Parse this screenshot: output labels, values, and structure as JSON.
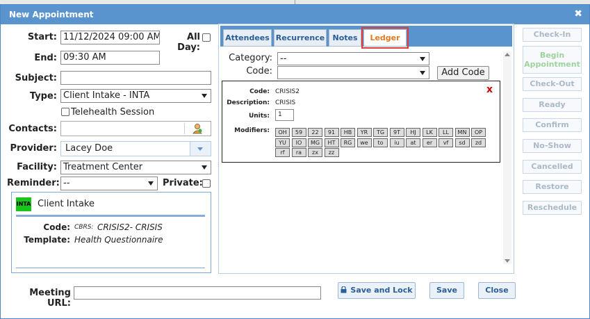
{
  "dialog": {
    "title": "New Appointment",
    "close_glyph": "✖"
  },
  "form": {
    "start_label": "Start:",
    "start_value": "11/12/2024 09:00 AM",
    "allday_label": "All Day:",
    "end_label": "End:",
    "end_value": "09:30 AM",
    "subject_label": "Subject:",
    "subject_value": "",
    "type_label": "Type:",
    "type_value": "Client Intake - INTA",
    "telehealth_label": "Telehealth Session",
    "contacts_label": "Contacts:",
    "contacts_value": "",
    "provider_label": "Provider:",
    "provider_value": "Lacey Doe",
    "facility_label": "Facility:",
    "facility_value": "Treatment Center",
    "reminder_label": "Reminder:",
    "reminder_value": "--",
    "private_label": "Private:"
  },
  "summary": {
    "badge": "INTA",
    "badge_color": "#19c41c",
    "title": "Client Intake",
    "code_label": "Code:",
    "code_prefix": "CBRS:",
    "code_value": "CRISIS2- CRISIS",
    "template_label": "Template:",
    "template_value": "Health Questionnaire"
  },
  "tabs": [
    {
      "label": "Attendees"
    },
    {
      "label": "Recurrence"
    },
    {
      "label": "Notes"
    },
    {
      "label": "Ledger"
    }
  ],
  "active_tab": "Ledger",
  "ledger": {
    "category_label": "Category:",
    "category_value": "--",
    "code_label": "Code:",
    "code_value": "",
    "add_code_label": "Add Code",
    "entry": {
      "code_label": "Code:",
      "code_value": "CRISIS2",
      "description_label": "Description:",
      "description_value": "CRISIS",
      "units_label": "Units:",
      "units_value": "1",
      "modifiers_label": "Modifiers:",
      "remove_glyph": "x",
      "modifiers": [
        "OH",
        "59",
        "22",
        "91",
        "HB",
        "YR",
        "TG",
        "9T",
        "HJ",
        "LK",
        "LL",
        "MN",
        "OP",
        "YU",
        "IO",
        "MG",
        "HT",
        "RG",
        "we",
        "to",
        "iu",
        "at",
        "er",
        "vf",
        "sd",
        "zd",
        "rf",
        "ra",
        "zx",
        "zz"
      ]
    }
  },
  "side_actions": [
    "Check-In",
    "Begin Appointment",
    "Check-Out",
    "Ready",
    "Confirm",
    "No-Show",
    "Cancelled",
    "Restore",
    "Reschedule"
  ],
  "footer": {
    "meeting_url_label": "Meeting URL:",
    "meeting_url_value": "",
    "save_lock_label": "Save and Lock",
    "save_label": "Save",
    "close_label": "Close"
  },
  "colors": {
    "titlebar": "#5a94cf",
    "active_tab_text": "#e07a1e",
    "remove_x": "#d40000"
  }
}
